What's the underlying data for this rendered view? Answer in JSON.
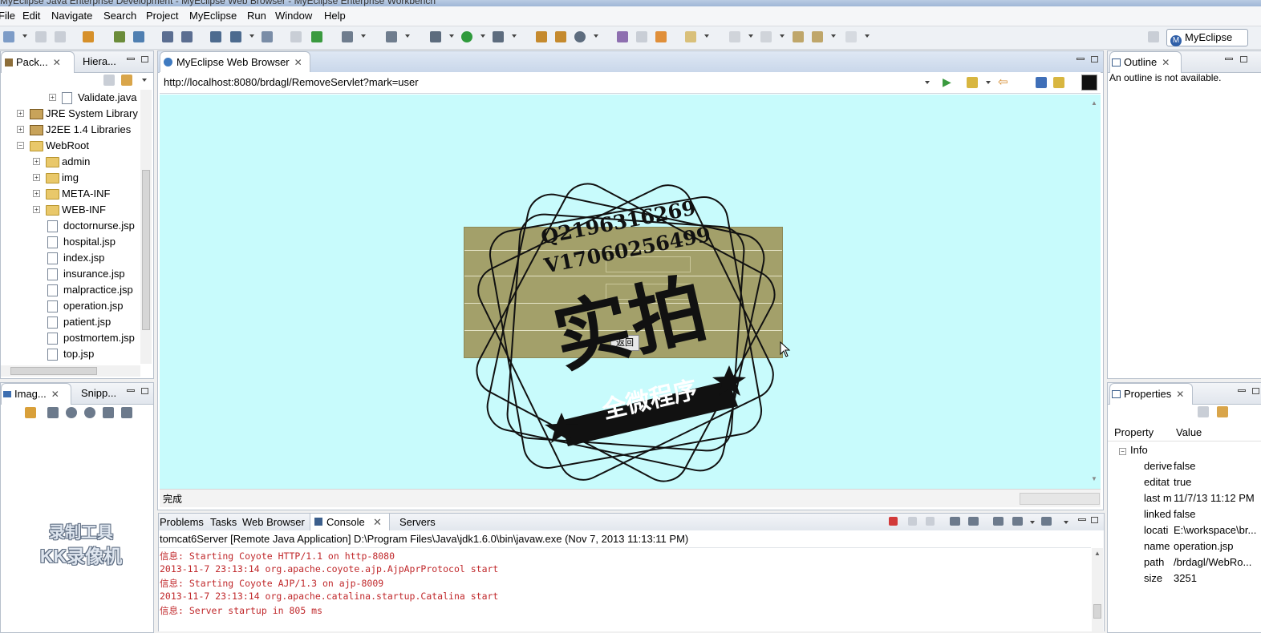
{
  "window": {
    "title": "MyEclipse Java Enterprise Development - MyEclipse Web Browser - MyEclipse Enterprise Workbench"
  },
  "menu": [
    "File",
    "Edit",
    "Navigate",
    "Search",
    "Project",
    "MyEclipse",
    "Run",
    "Window",
    "Help"
  ],
  "perspective": {
    "label": "MyEclipse J..."
  },
  "package_explorer": {
    "tabs": [
      "Pack...",
      "Hiera..."
    ],
    "tree": [
      {
        "label": "Validate.java",
        "type": "file"
      },
      {
        "label": "JRE System Library",
        "type": "lib"
      },
      {
        "label": "J2EE 1.4 Libraries",
        "type": "lib"
      },
      {
        "label": "WebRoot",
        "type": "folder"
      },
      {
        "label": "admin",
        "type": "folder"
      },
      {
        "label": "img",
        "type": "folder"
      },
      {
        "label": "META-INF",
        "type": "folder"
      },
      {
        "label": "WEB-INF",
        "type": "folder"
      },
      {
        "label": "doctornurse.jsp",
        "type": "file"
      },
      {
        "label": "hospital.jsp",
        "type": "file"
      },
      {
        "label": "index.jsp",
        "type": "file"
      },
      {
        "label": "insurance.jsp",
        "type": "file"
      },
      {
        "label": "malpractice.jsp",
        "type": "file"
      },
      {
        "label": "operation.jsp",
        "type": "file"
      },
      {
        "label": "patient.jsp",
        "type": "file"
      },
      {
        "label": "postmortem.jsp",
        "type": "file"
      },
      {
        "label": "top.jsp",
        "type": "file"
      }
    ]
  },
  "image_panel": {
    "tabs": [
      "Imag...",
      "Snipp..."
    ]
  },
  "browser": {
    "tab": "MyEclipse Web Browser",
    "url": "http://localhost:8080/brdagl/RemoveServlet?mark=user",
    "status": "完成",
    "form_button": "返回"
  },
  "watermark": {
    "line1": "Q2196316269",
    "line2": "V17060256499",
    "big": "实拍",
    "ribbon": "全微程序"
  },
  "recorder_logo": {
    "line1": "录制工具",
    "line2": "KK录像机"
  },
  "console": {
    "tabs": [
      "Problems",
      "Tasks",
      "Web Browser",
      "Console",
      "Servers"
    ],
    "header": "tomcat6Server [Remote Java Application] D:\\Program Files\\Java\\jdk1.6.0\\bin\\javaw.exe (Nov 7, 2013 11:13:11 PM)",
    "lines": [
      "信息: Starting Coyote HTTP/1.1 on http-8080",
      "2013-11-7 23:13:14 org.apache.coyote.ajp.AjpAprProtocol start",
      "信息: Starting Coyote AJP/1.3 on ajp-8009",
      "2013-11-7 23:13:14 org.apache.catalina.startup.Catalina start",
      "信息: Server startup in 805 ms"
    ]
  },
  "outline": {
    "tab": "Outline",
    "message": "An outline is not available."
  },
  "properties": {
    "tab": "Properties",
    "col_property": "Property",
    "col_value": "Value",
    "group": "Info",
    "rows": [
      {
        "key": "derive",
        "value": "false"
      },
      {
        "key": "editat",
        "value": "true"
      },
      {
        "key": "last m",
        "value": "11/7/13 11:12 PM"
      },
      {
        "key": "linked",
        "value": "false"
      },
      {
        "key": "locati",
        "value": "E:\\workspace\\br..."
      },
      {
        "key": "name",
        "value": "operation.jsp"
      },
      {
        "key": "path",
        "value": "/brdagl/WebRo..."
      },
      {
        "key": "size",
        "value": "3251"
      }
    ]
  },
  "colors": {
    "browser_bg": "#c8fbfc",
    "form_bg": "#a3a06a",
    "console_red": "#c0282b",
    "accent": "#2f5fa8"
  }
}
